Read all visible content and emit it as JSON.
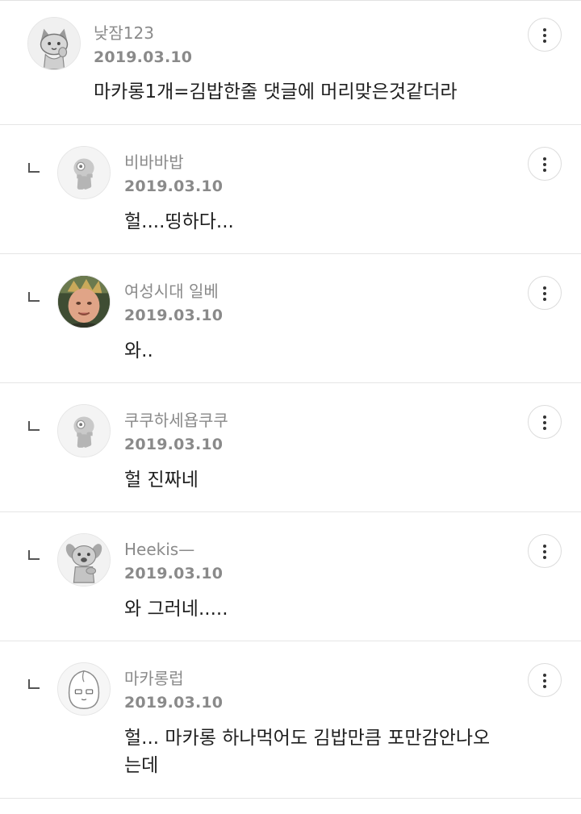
{
  "comments": [
    {
      "nickname": "낮잠123",
      "date": "2019.03.10",
      "text": "마카롱1개=김밥한줄 댓글에 머리맞은것같더라",
      "avatar_icon": "cartoon-cat-icon"
    },
    {
      "nickname": "비바바밥",
      "date": "2019.03.10",
      "text": "헐....띵하다...",
      "avatar_icon": "default-character-icon"
    },
    {
      "nickname": "여성시대 일베",
      "date": "2019.03.10",
      "text": "와..",
      "avatar_icon": "photo-avatar"
    },
    {
      "nickname": "쿠쿠하세욥쿠쿠",
      "date": "2019.03.10",
      "text": "헐 진짜네",
      "avatar_icon": "default-character-icon"
    },
    {
      "nickname": "Heekis—",
      "date": "2019.03.10",
      "text": "와 그러네.....",
      "avatar_icon": "cartoon-dog-icon"
    },
    {
      "nickname": "마카롱럽",
      "date": "2019.03.10",
      "text": "헐... 마카롱 하나먹어도 김밥만큼 포만감안나오\n는데",
      "avatar_icon": "cartoon-peach-icon"
    }
  ]
}
